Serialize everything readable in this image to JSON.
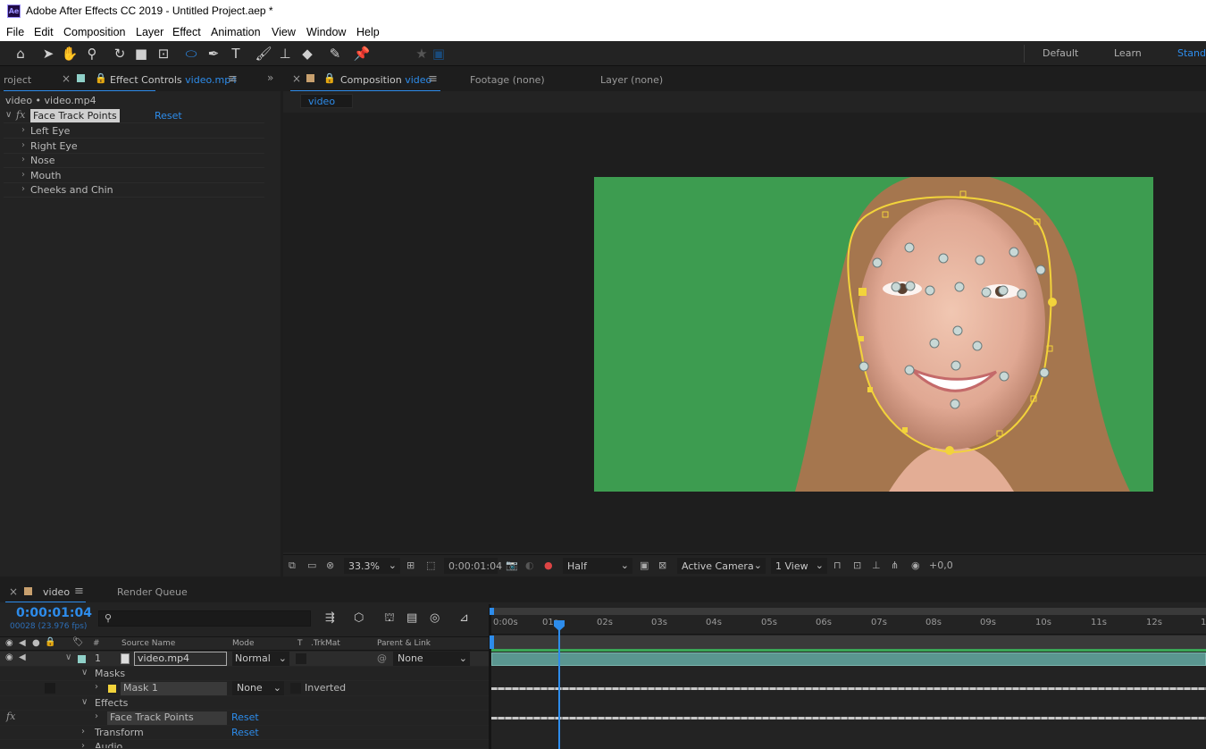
{
  "title_bar": {
    "title": "Adobe After Effects CC 2019 - Untitled Project.aep *",
    "app_icon_text": "Ae"
  },
  "menu": [
    "File",
    "Edit",
    "Composition",
    "Layer",
    "Effect",
    "Animation",
    "View",
    "Window",
    "Help"
  ],
  "workspaces": {
    "default": "Default",
    "learn": "Learn",
    "standard": "Standa"
  },
  "left_panel": {
    "project_tab": "roject",
    "effect_controls_label": "Effect Controls",
    "effect_controls_target": "video.mp4",
    "breadcrumb": "video • video.mp4",
    "effect_name": "Face Track Points",
    "reset": "Reset",
    "groups": [
      "Left Eye",
      "Right Eye",
      "Nose",
      "Mouth",
      "Cheeks and Chin"
    ]
  },
  "viewer_tabs": {
    "composition_label": "Composition",
    "composition_name": "video",
    "footage": "Footage  (none)",
    "layer": "Layer  (none)",
    "breadcrumb": "video"
  },
  "viewer_bar": {
    "zoom": "33.3%",
    "timecode": "0:00:01:04",
    "resolution": "Half",
    "camera": "Active Camera",
    "views": "1 View",
    "exposure": "+0,0"
  },
  "timeline": {
    "comp_tab": "video",
    "render_queue": "Render Queue",
    "current_time": "0:00:01:04",
    "frame_info": "00028 (23.976 fps)",
    "search_placeholder": "",
    "columns": {
      "num": "#",
      "source": "Source Name",
      "mode": "Mode",
      "t": "T",
      "trkmat": ".TrkMat",
      "parent": "Parent & Link"
    },
    "layer": {
      "index": "1",
      "name": "video.mp4",
      "mode": "Normal",
      "parent": "None"
    },
    "masks_label": "Masks",
    "mask_name": "Mask 1",
    "mask_mode": "None",
    "mask_inverted": "Inverted",
    "effects_label": "Effects",
    "effect_name": "Face Track Points",
    "effect_reset": "Reset",
    "transform_label": "Transform",
    "transform_reset": "Reset",
    "audio_label": "Audio",
    "fx_icon": "fx",
    "ruler": [
      "0:00s",
      "01s",
      "02s",
      "03s",
      "04s",
      "05s",
      "06s",
      "07s",
      "08s",
      "09s",
      "10s",
      "11s",
      "12s",
      "1"
    ]
  },
  "colors": {
    "accent_blue": "#2d8ceb",
    "label_aqua": "#8fd0c8",
    "label_tan": "#c8a06e",
    "mask_yellow": "#f2d33b",
    "green_screen": "#3a9a4e"
  }
}
